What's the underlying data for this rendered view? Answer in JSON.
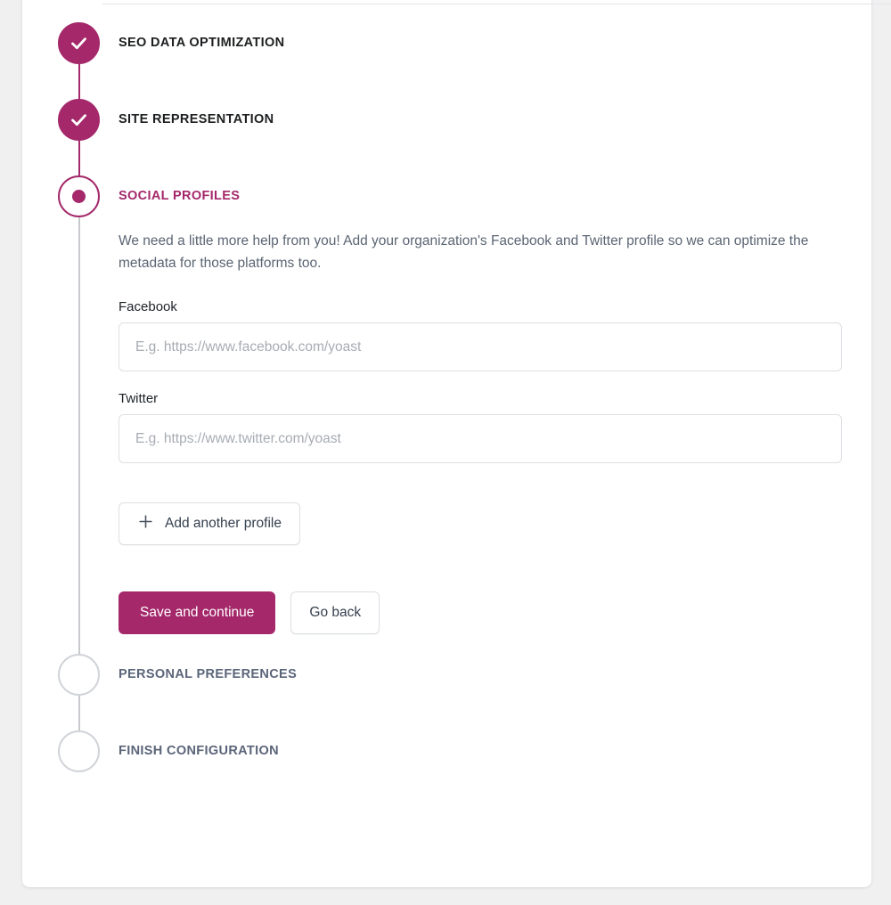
{
  "card": {
    "divider": "section-divider"
  },
  "steps": [
    {
      "label": "SEO data optimization",
      "state": "done",
      "icon": "check-icon"
    },
    {
      "label": "Site representation",
      "state": "done",
      "icon": "check-icon"
    },
    {
      "label": "Social profiles",
      "state": "active",
      "icon": "dot-icon"
    },
    {
      "label": "Personal preferences",
      "state": "todo",
      "icon": "empty-circle-icon"
    },
    {
      "label": "Finish configuration",
      "state": "todo",
      "icon": "empty-circle-icon"
    }
  ],
  "social_profiles": {
    "description": "We need a little more help from you! Add your organization's Facebook and Twitter profile so we can optimize the metadata for those platforms too.",
    "fields": [
      {
        "label": "Facebook",
        "value": "",
        "placeholder": "E.g. https://www.facebook.com/yoast"
      },
      {
        "label": "Twitter",
        "value": "",
        "placeholder": "E.g. https://www.twitter.com/yoast"
      }
    ],
    "add_profile_label": "Add another profile",
    "add_profile_icon": "plus-icon",
    "save_label": "Save and continue",
    "back_label": "Go back"
  },
  "colors": {
    "accent": "#a4286a",
    "page_background": "#f0f0f1",
    "card_background": "#ffffff",
    "border": "#dcdfe3",
    "muted_text": "#5b6573",
    "inactive_step": "#5b6579",
    "inactive_circle": "#d0d3d8"
  }
}
